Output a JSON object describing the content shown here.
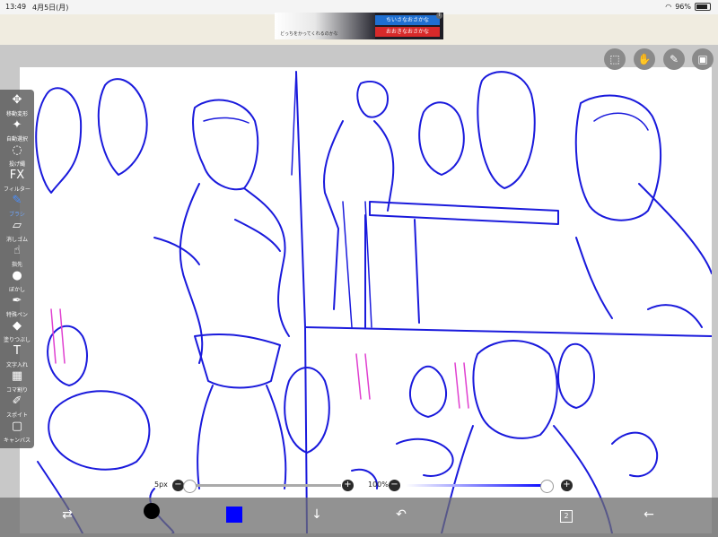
{
  "status": {
    "time": "13:49",
    "date": "4月5日(月)",
    "battery": "96%"
  },
  "ad": {
    "button_top": "ちいさなおさかな",
    "button_bottom": "おおきなおさかな",
    "info": "i",
    "tagline": "どっちをかってくれるのかな"
  },
  "toolbar": {
    "items": [
      {
        "label": "移動変形",
        "icon": "move-icon",
        "glyph": "✥"
      },
      {
        "label": "自動選択",
        "icon": "magic-wand-icon",
        "glyph": "✦"
      },
      {
        "label": "投げ縄",
        "icon": "lasso-icon",
        "glyph": "◌"
      },
      {
        "label": "フィルター",
        "icon": "filter-fx-icon",
        "glyph": "FX"
      },
      {
        "label": "ブラシ",
        "icon": "brush-icon",
        "glyph": "✎"
      },
      {
        "label": "消しゴム",
        "icon": "eraser-icon",
        "glyph": "▱"
      },
      {
        "label": "指先",
        "icon": "smudge-icon",
        "glyph": "☝"
      },
      {
        "label": "ぼかし",
        "icon": "blur-icon",
        "glyph": "●"
      },
      {
        "label": "特殊ペン",
        "icon": "special-pen-icon",
        "glyph": "✒"
      },
      {
        "label": "塗りつぶし",
        "icon": "bucket-icon",
        "glyph": "◆"
      },
      {
        "label": "文字入れ",
        "icon": "text-icon",
        "glyph": "T"
      },
      {
        "label": "コマ割り",
        "icon": "frame-divide-icon",
        "glyph": "▦"
      },
      {
        "label": "スポイト",
        "icon": "eyedropper-icon",
        "glyph": "✐"
      },
      {
        "label": "キャンバス",
        "icon": "canvas-icon",
        "glyph": "▢"
      }
    ],
    "active_index": 4
  },
  "brush": {
    "size_label": "5px",
    "size_fraction": 0.0,
    "opacity_label": "100%",
    "opacity_fraction": 1.0,
    "color": "#0000ff"
  },
  "bottom": {
    "layer_count": "2"
  },
  "colors": {
    "ink": "#1a1adc",
    "pink": "#e040d0"
  }
}
